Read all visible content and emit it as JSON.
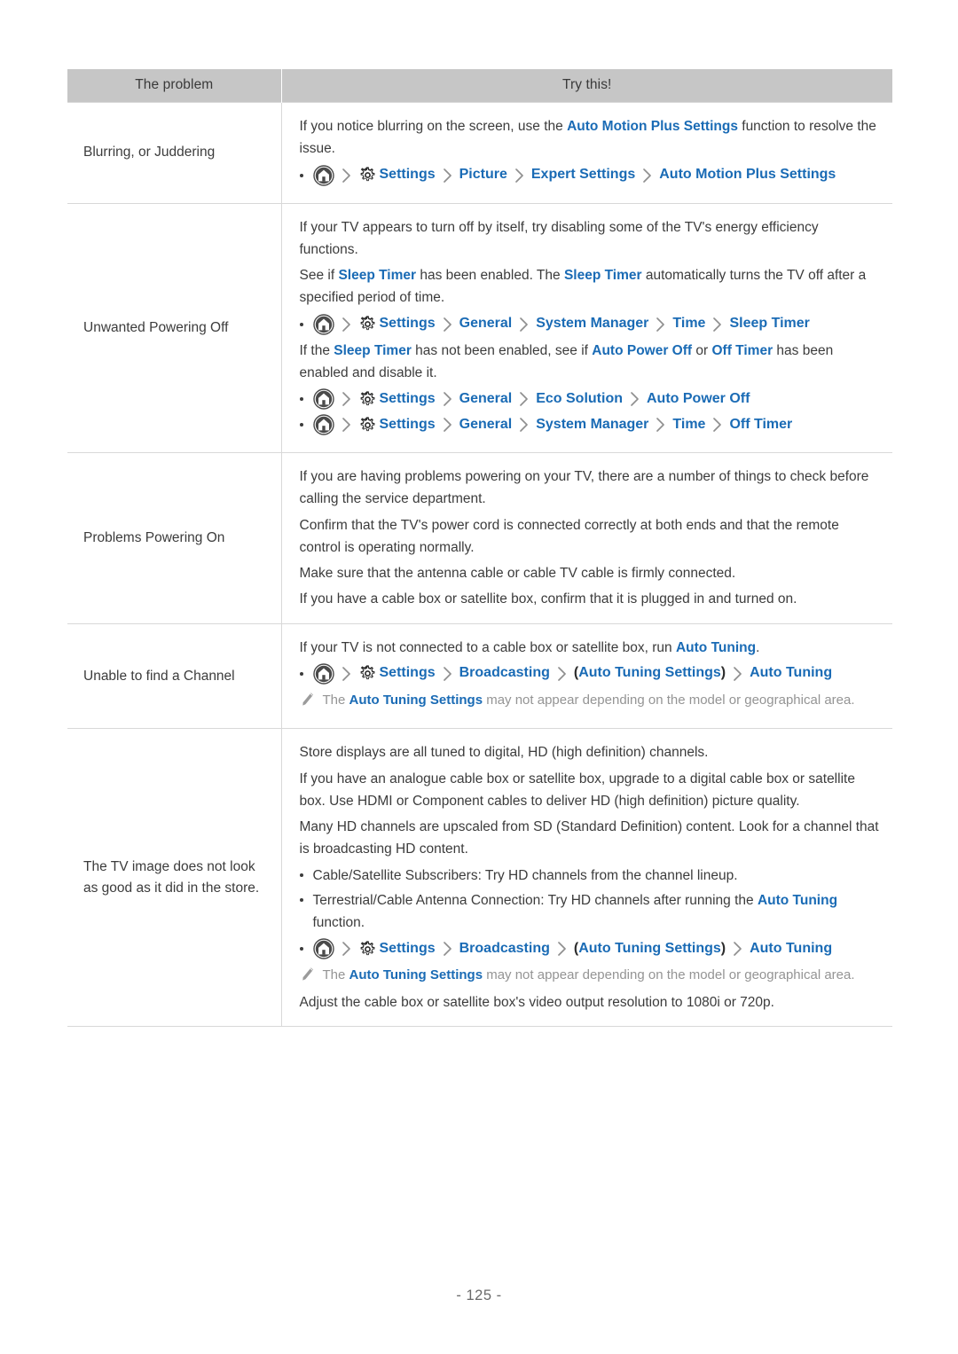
{
  "page": {
    "page_number_label": "- 125 -"
  },
  "table": {
    "headers": [
      "The problem",
      "Try this!"
    ],
    "rows": [
      {
        "problem": [
          "Blurring, or Juddering"
        ],
        "blocks": [
          {
            "type": "paragraph",
            "runs": [
              {
                "text": "If you notice blurring on the screen, use the ",
                "style": "plain"
              },
              {
                "text": "Auto Motion Plus Settings",
                "style": "blue"
              },
              {
                "text": " function to resolve the issue.",
                "style": "plain"
              }
            ]
          },
          {
            "type": "path",
            "segments": [
              "Settings",
              "Picture",
              "Expert Settings",
              "Auto Motion Plus Settings"
            ]
          }
        ]
      },
      {
        "problem": [
          "Unwanted Powering Off"
        ],
        "blocks": [
          {
            "type": "paragraph",
            "runs": [
              {
                "text": "If your TV appears to turn off by itself, try disabling some of the TV's energy efficiency functions.",
                "style": "plain"
              }
            ]
          },
          {
            "type": "paragraph",
            "runs": [
              {
                "text": "See if ",
                "style": "plain"
              },
              {
                "text": "Sleep Timer",
                "style": "blue"
              },
              {
                "text": " has been enabled. The ",
                "style": "plain"
              },
              {
                "text": "Sleep Timer",
                "style": "blue"
              },
              {
                "text": " automatically turns the TV off after a specified period of time.",
                "style": "plain"
              }
            ]
          },
          {
            "type": "path",
            "segments": [
              "Settings",
              "General",
              "System Manager",
              "Time",
              "Sleep Timer"
            ]
          },
          {
            "type": "paragraph",
            "runs": [
              {
                "text": "If the ",
                "style": "plain"
              },
              {
                "text": "Sleep Timer",
                "style": "blue"
              },
              {
                "text": " has not been enabled, see if ",
                "style": "plain"
              },
              {
                "text": "Auto Power Off",
                "style": "blue"
              },
              {
                "text": " or ",
                "style": "plain"
              },
              {
                "text": "Off Timer",
                "style": "blue"
              },
              {
                "text": " has been enabled and disable it.",
                "style": "plain"
              }
            ]
          },
          {
            "type": "path",
            "segments": [
              "Settings",
              "General",
              "Eco Solution",
              "Auto Power Off"
            ]
          },
          {
            "type": "path",
            "segments": [
              "Settings",
              "General",
              "System Manager",
              "Time",
              "Off Timer"
            ]
          }
        ]
      },
      {
        "problem": [
          "Problems Powering On"
        ],
        "blocks": [
          {
            "type": "paragraph",
            "runs": [
              {
                "text": "If you are having problems powering on your TV, there are a number of things to check before calling the service department.",
                "style": "plain"
              }
            ]
          },
          {
            "type": "paragraph",
            "runs": [
              {
                "text": "Confirm that the TV's power cord is connected correctly at both ends and that the remote control is operating normally.",
                "style": "plain"
              }
            ]
          },
          {
            "type": "paragraph",
            "runs": [
              {
                "text": "Make sure that the antenna cable or cable TV cable is firmly connected.",
                "style": "plain"
              }
            ]
          },
          {
            "type": "paragraph",
            "runs": [
              {
                "text": "If you have a cable box or satellite box, confirm that it is plugged in and turned on.",
                "style": "plain"
              }
            ]
          }
        ]
      },
      {
        "problem": [
          "Unable to find a Channel"
        ],
        "blocks": [
          {
            "type": "paragraph",
            "runs": [
              {
                "text": "If your TV is not connected to a cable box or satellite box, run ",
                "style": "plain"
              },
              {
                "text": "Auto Tuning",
                "style": "blue"
              },
              {
                "text": ".",
                "style": "plain"
              }
            ]
          },
          {
            "type": "path",
            "segments": [
              "Settings",
              "Broadcasting",
              "(Auto Tuning Settings)",
              "Auto Tuning"
            ]
          },
          {
            "type": "note",
            "runs": [
              {
                "text": "The ",
                "style": "plain"
              },
              {
                "text": "Auto Tuning Settings",
                "style": "blue"
              },
              {
                "text": " may not appear depending on the model or geographical area.",
                "style": "plain"
              }
            ]
          }
        ]
      },
      {
        "problem": [
          "The TV image does not look",
          "as good as it did in the store."
        ],
        "blocks": [
          {
            "type": "paragraph",
            "runs": [
              {
                "text": "Store displays are all tuned to digital, HD (high definition) channels.",
                "style": "plain"
              }
            ]
          },
          {
            "type": "paragraph",
            "runs": [
              {
                "text": "If you have an analogue cable box or satellite box, upgrade to a digital cable box or satellite box. Use HDMI or Component cables to deliver HD (high definition) picture quality.",
                "style": "plain"
              }
            ]
          },
          {
            "type": "paragraph",
            "runs": [
              {
                "text": "Many HD channels are upscaled from SD (Standard Definition) content. Look for a channel that is broadcasting HD content.",
                "style": "plain"
              }
            ]
          },
          {
            "type": "bullet",
            "runs": [
              {
                "text": "Cable/Satellite Subscribers: Try HD channels from the channel lineup.",
                "style": "plain"
              }
            ]
          },
          {
            "type": "bullet",
            "runs": [
              {
                "text": "Terrestrial/Cable Antenna Connection: Try HD channels after running the ",
                "style": "plain"
              },
              {
                "text": "Auto Tuning",
                "style": "blue"
              },
              {
                "text": " function.",
                "style": "plain"
              }
            ]
          },
          {
            "type": "path",
            "segments": [
              "Settings",
              "Broadcasting",
              "(Auto Tuning Settings)",
              "Auto Tuning"
            ]
          },
          {
            "type": "note",
            "runs": [
              {
                "text": "The ",
                "style": "plain"
              },
              {
                "text": "Auto Tuning Settings",
                "style": "blue"
              },
              {
                "text": " may not appear depending on the model or geographical area.",
                "style": "plain"
              }
            ]
          },
          {
            "type": "paragraph",
            "runs": [
              {
                "text": "Adjust the cable box or satellite box's video output resolution to 1080i or 720p.",
                "style": "plain"
              }
            ]
          }
        ]
      }
    ]
  },
  "icons": {
    "home": "home-icon",
    "gear": "gear-icon",
    "chevron": "chevron-right-icon",
    "pencil": "pencil-note-icon"
  },
  "colors": {
    "link_blue": "#1a6bb5",
    "header_bg": "#c6c6c6",
    "body_text": "#3c3c3c",
    "note_gray": "#949494",
    "border": "#d8d8d8"
  }
}
